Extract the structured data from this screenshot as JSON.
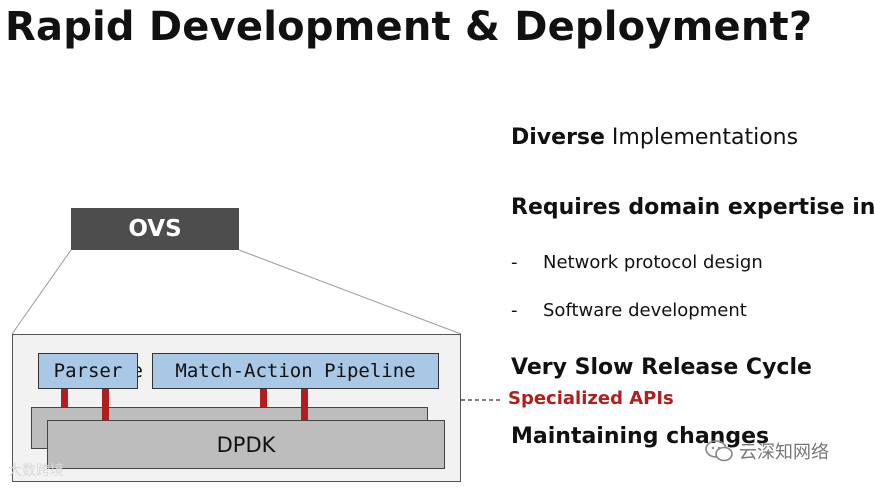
{
  "title": "Rapid Development & Deployment?",
  "diagram": {
    "ovs_label": "OVS",
    "parser_label": "Parser",
    "hidden_text": "ke",
    "pipeline_label": "Match-Action Pipeline",
    "dpdk_label": "DPDK",
    "api_label": "Specialized APIs"
  },
  "points": {
    "diverse_bold": "Diverse",
    "diverse_rest": " Implementations",
    "expertise": "Requires domain expertise in:",
    "bullets": [
      {
        "dash": "-",
        "text": "Network protocol design"
      },
      {
        "dash": "-",
        "text": "Software development"
      }
    ],
    "release": "Very Slow Release Cycle",
    "maintaining": "Maintaining changes"
  },
  "watermarks": {
    "left": "大数跨境",
    "right": "云深知网络"
  },
  "colors": {
    "accent_red": "#b01e1e",
    "box_blue": "#a9c8e5",
    "ovs_gray": "#4d4d4d"
  }
}
